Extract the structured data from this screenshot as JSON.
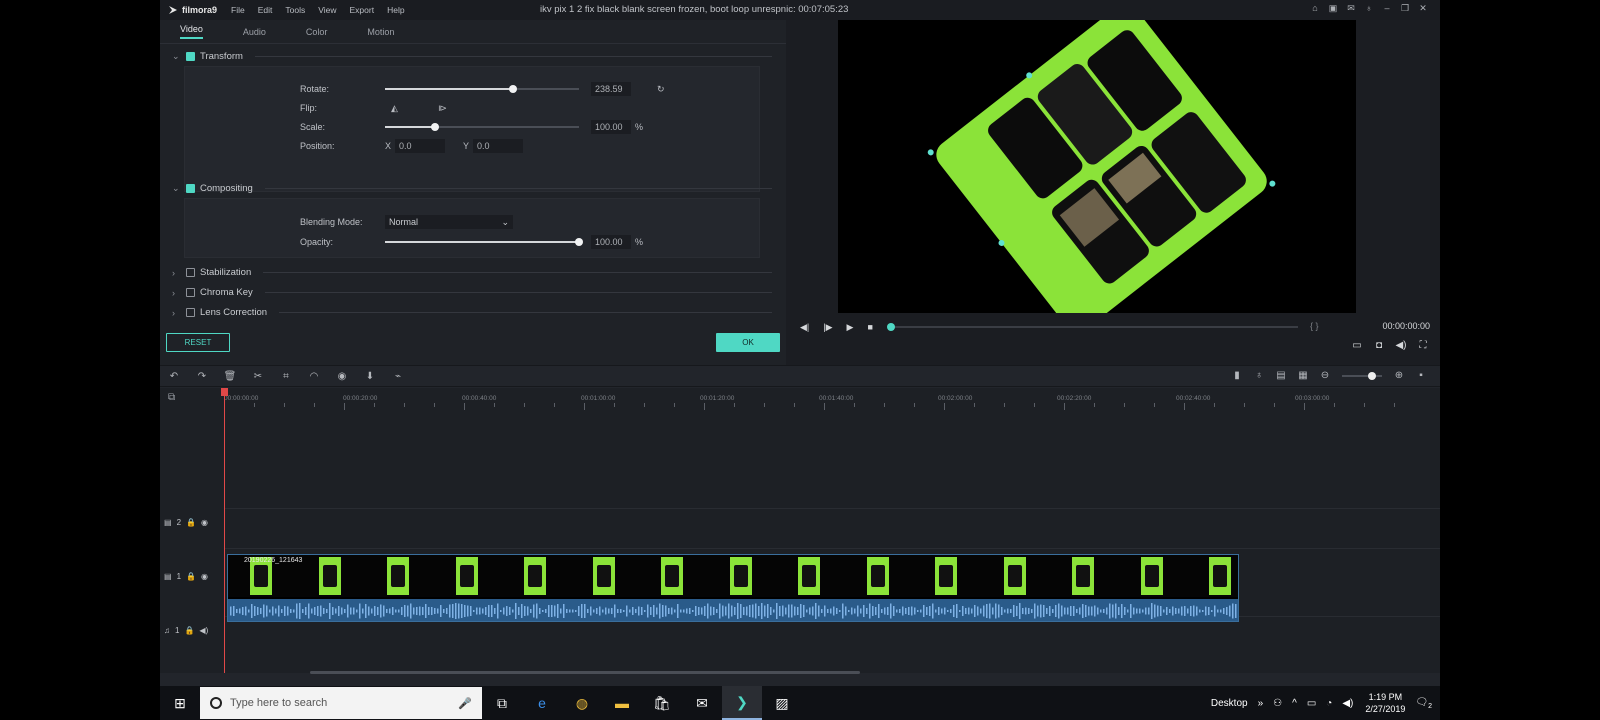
{
  "titlebar": {
    "app_name": "filmora9",
    "menu": [
      "File",
      "Edit",
      "Tools",
      "View",
      "Export",
      "Help"
    ],
    "doc_title": "ikv pix 1 2 fix black blank screen frozen, boot loop unrespnic: 00:07:05:23"
  },
  "tabs": [
    "Video",
    "Audio",
    "Color",
    "Motion"
  ],
  "transform": {
    "title": "Transform",
    "rotate_label": "Rotate:",
    "rotate_value": "238.59",
    "rotate_fraction": 0.66,
    "flip_label": "Flip:",
    "scale_label": "Scale:",
    "scale_value": "100.00",
    "scale_fraction": 0.26,
    "scale_unit": "%",
    "position_label": "Position:",
    "x_label": "X",
    "x_value": "0.0",
    "y_label": "Y",
    "y_value": "0.0"
  },
  "compositing": {
    "title": "Compositing",
    "blend_label": "Blending Mode:",
    "blend_value": "Normal",
    "opacity_label": "Opacity:",
    "opacity_value": "100.00",
    "opacity_fraction": 1.0,
    "opacity_unit": "%"
  },
  "collapsed_sections": [
    "Stabilization",
    "Chroma Key",
    "Lens Correction"
  ],
  "buttons": {
    "reset": "RESET",
    "ok": "OK"
  },
  "preview": {
    "timecode": "00:00:00:00",
    "braces": "{ }"
  },
  "timeline": {
    "ruler_labels": [
      "00:00:00:00",
      "00:00:20:00",
      "00:00:40:00",
      "00:01:00:00",
      "00:01:20:00",
      "00:01:40:00",
      "00:02:00:00",
      "00:02:20:00",
      "00:02:40:00",
      "00:03:00:00"
    ],
    "track_ids": [
      "2",
      "1",
      "1"
    ],
    "clip_name": "20190226_121643"
  },
  "taskbar": {
    "search_placeholder": "Type here to search",
    "desktop_label": "Desktop",
    "time": "1:19 PM",
    "date": "2/27/2019",
    "notification_count": "2"
  },
  "colors": {
    "accent": "#4fd8c4",
    "green_screen": "#8be339",
    "playhead": "#e04848",
    "audio": "#2a5b8a"
  }
}
